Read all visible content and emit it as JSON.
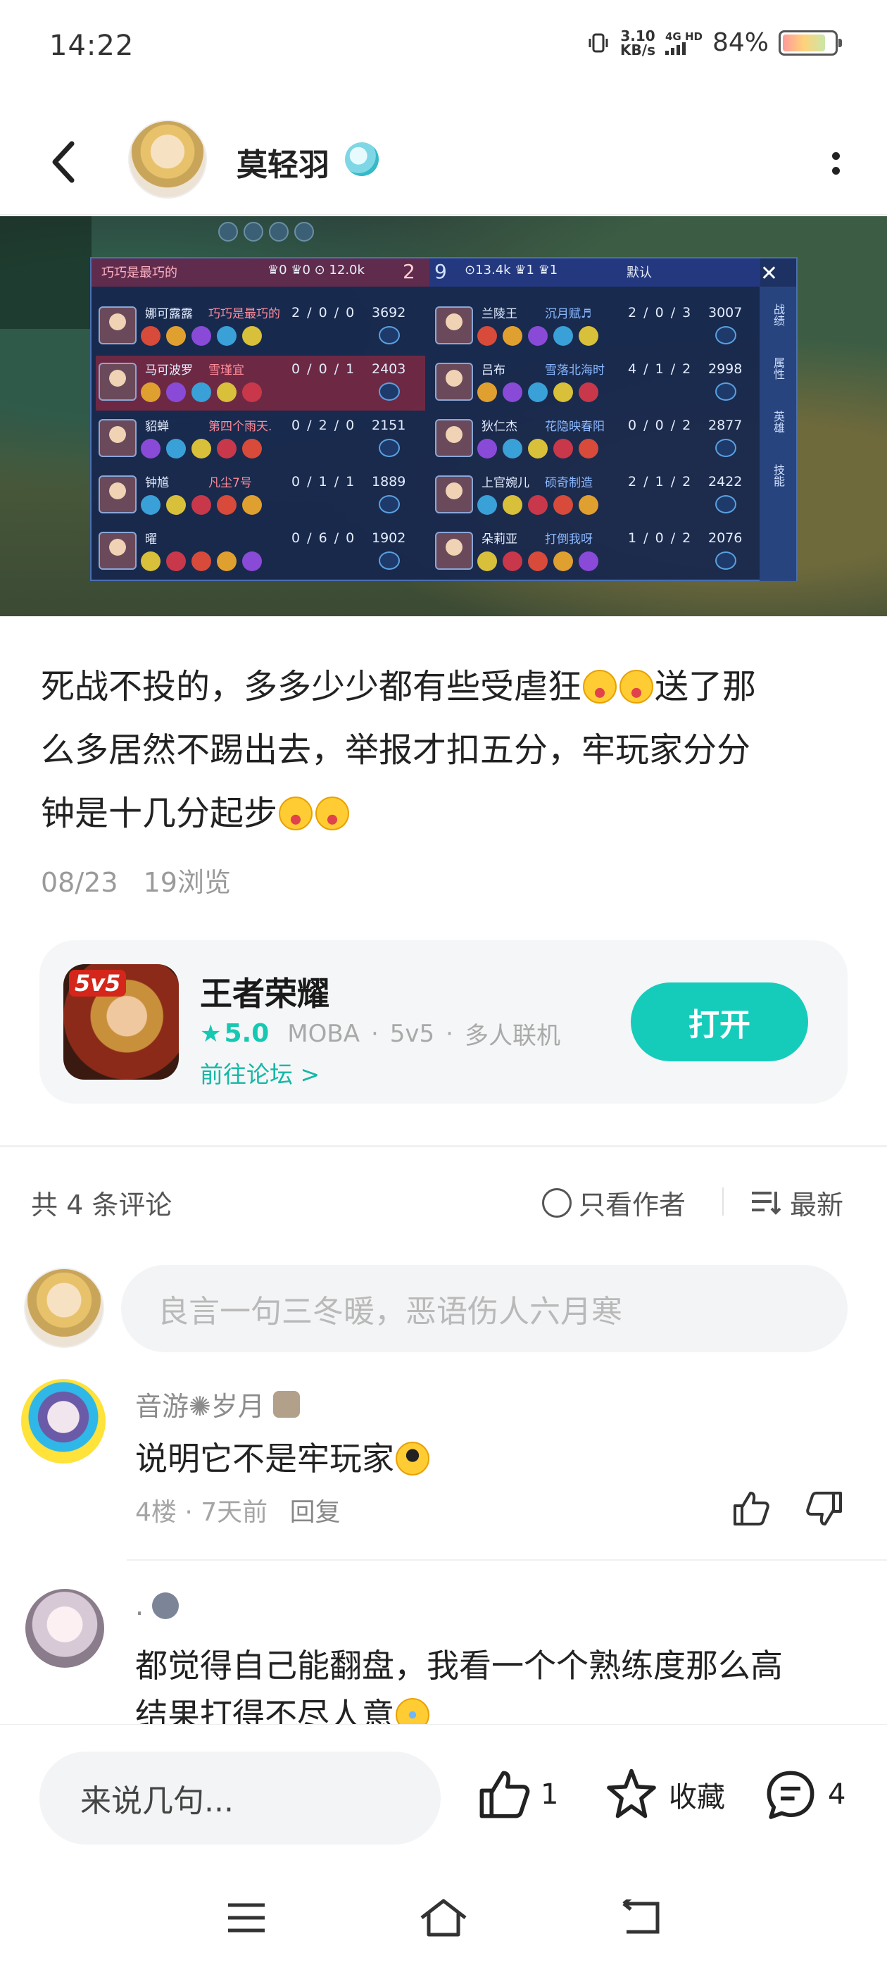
{
  "status_bar": {
    "time": "14:22",
    "net_speed_value": "3.10",
    "net_speed_unit": "KB/s",
    "network": "4G HD",
    "battery": "84%",
    "battery_level": 0.84
  },
  "header": {
    "author_name": "莫轻羽",
    "back_icon": "chevron-left-icon",
    "more_icon": "vertical-dots-icon"
  },
  "scoreboard": {
    "left_tag": "巧巧是最巧的",
    "left_stats": "♛0 ♛0 ⊙ 12.0k",
    "red_score": "2",
    "blue_score": "9",
    "right_stats": "⊙13.4k ♛1 ♛1",
    "default_label": "默认",
    "side_tabs": [
      "战绩",
      "属性",
      "英雄",
      "技能"
    ],
    "left_team": [
      {
        "hero": "娜可露露",
        "player": "巧巧是最巧的",
        "kda": "2 / 0 / 0",
        "gold": "3692"
      },
      {
        "hero": "马可波罗",
        "player": "雪瑾宜",
        "kda": "0 / 0 / 1",
        "gold": "2403"
      },
      {
        "hero": "貂蝉",
        "player": "第四个雨天.",
        "kda": "0 / 2 / 0",
        "gold": "2151"
      },
      {
        "hero": "钟馗",
        "player": "凡尘7号",
        "kda": "0 / 1 / 1",
        "gold": "1889"
      },
      {
        "hero": "曜",
        "player": "",
        "kda": "0 / 6 / 0",
        "gold": "1902"
      }
    ],
    "right_team": [
      {
        "hero": "兰陵王",
        "player": "沉月赋♬",
        "kda": "2 / 0 / 3",
        "gold": "3007"
      },
      {
        "hero": "吕布",
        "player": "雪落北海时",
        "kda": "4 / 1 / 2",
        "gold": "2998"
      },
      {
        "hero": "狄仁杰",
        "player": "花隐映春阳",
        "kda": "0 / 0 / 2",
        "gold": "2877"
      },
      {
        "hero": "上官婉儿",
        "player": "硕奇制造",
        "kda": "2 / 1 / 2",
        "gold": "2422"
      },
      {
        "hero": "朵莉亚",
        "player": "打倒我呀",
        "kda": "1 / 0 / 2",
        "gold": "2076"
      }
    ]
  },
  "post": {
    "line1": "死战不投的，多多少少都有些受虐狂",
    "line1_end": "送了那",
    "line2": "么多居然不踢出去，举报才扣五分，牢玩家分分",
    "line3": "钟是十几分起步",
    "date": "08/23",
    "views": "19浏览"
  },
  "app_card": {
    "badge": "5v5",
    "name": "王者荣耀",
    "rating": "5.0",
    "tags": [
      "MOBA",
      "5v5",
      "多人联机"
    ],
    "forum_link": "前往论坛 >",
    "open_button": "打开"
  },
  "comments_header": {
    "count": "共 4 条评论",
    "only_author": "只看作者",
    "sort": "最新"
  },
  "comment_input_placeholder": "良言一句三冬暖，恶语伤人六月寒",
  "comments": [
    {
      "author": "音游✺岁月",
      "text": "说明它不是牢玩家",
      "floor": "4楼",
      "time": "7天前",
      "reply": "回复"
    },
    {
      "author": ".",
      "text_line1": "都觉得自己能翻盘，我看一个个熟练度那么高",
      "text_line2": "结果打得不尽人意"
    }
  ],
  "bottom_bar": {
    "say_placeholder": "来说几句...",
    "like_count": "1",
    "favorite": "收藏",
    "comment_count": "4"
  },
  "colors": {
    "accent": "#15ccbb",
    "link": "#14b8a6"
  }
}
